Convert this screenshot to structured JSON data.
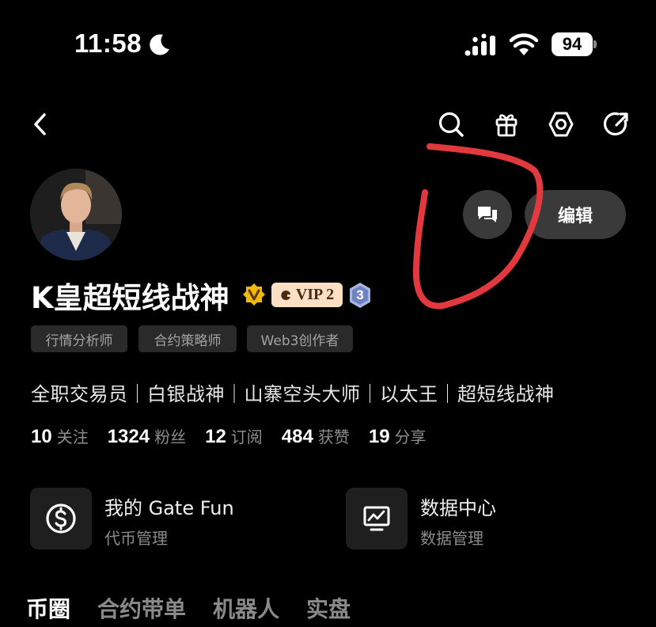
{
  "status_bar": {
    "time": "11:58",
    "battery": "94"
  },
  "profile": {
    "username": "K皇超短线战神",
    "vip_label": "VIP 2",
    "level": "3",
    "edit_label": "编辑",
    "tags": [
      "行情分析师",
      "合约策略师",
      "Web3创作者"
    ],
    "bio": "全职交易员｜白银战神｜山寨空头大师｜以太王｜超短线战神"
  },
  "stats": [
    {
      "value": "10",
      "label": "关注"
    },
    {
      "value": "1324",
      "label": "粉丝"
    },
    {
      "value": "12",
      "label": "订阅"
    },
    {
      "value": "484",
      "label": "获赞"
    },
    {
      "value": "19",
      "label": "分享"
    }
  ],
  "features": [
    {
      "title": "我的 Gate Fun",
      "subtitle": "代币管理",
      "icon": "dollar-circle-icon"
    },
    {
      "title": "数据中心",
      "subtitle": "数据管理",
      "icon": "monitor-chart-icon"
    }
  ],
  "tabs": [
    "币圈",
    "合约带单",
    "机器人",
    "实盘"
  ],
  "colors": {
    "background": "#000000",
    "annotation": "#e2393f",
    "vip_bg": "#fbe0c4",
    "verified": "#f0b90b"
  }
}
